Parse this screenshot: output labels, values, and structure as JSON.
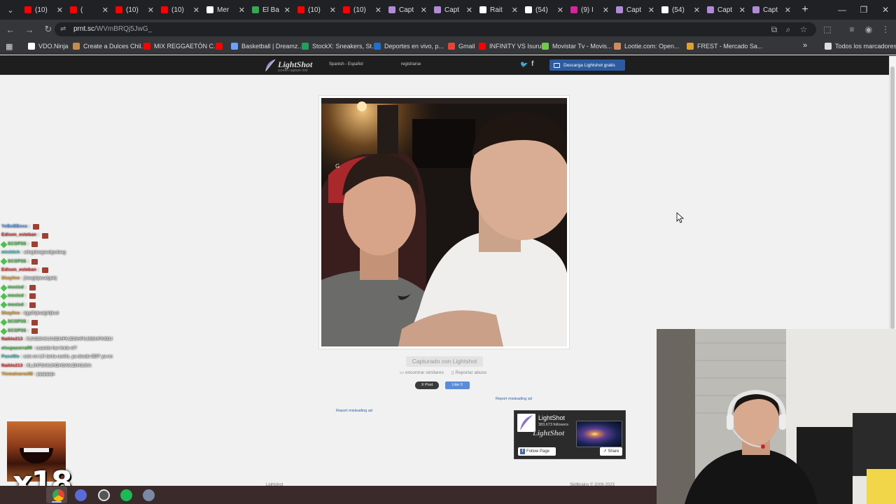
{
  "browser": {
    "tabs": [
      {
        "title": "(10)",
        "color": "#ff0000"
      },
      {
        "title": "(",
        "color": "#ff0000"
      },
      {
        "title": "(10)",
        "color": "#ff0000"
      },
      {
        "title": "(10)",
        "color": "#ff0000"
      },
      {
        "title": "Mer",
        "color": "#ffffff"
      },
      {
        "title": "El Ba",
        "color": "#34a853"
      },
      {
        "title": "(10)",
        "color": "#ff0000"
      },
      {
        "title": "(10)",
        "color": "#ff0000"
      },
      {
        "title": "Capt",
        "color": "#b38ad6"
      },
      {
        "title": "Capt",
        "color": "#b38ad6"
      },
      {
        "title": "Rait",
        "color": "#ffffff"
      },
      {
        "title": "(54)",
        "color": "#ffffff"
      },
      {
        "title": "(9) I",
        "color": "#d6249f"
      },
      {
        "title": "Capt",
        "color": "#b38ad6"
      },
      {
        "title": "(54)",
        "color": "#ffffff"
      },
      {
        "title": "Capt",
        "color": "#b38ad6"
      },
      {
        "title": "Capt",
        "color": "#b38ad6"
      }
    ],
    "new_tab": "+",
    "address": {
      "domain": "prnt.sc",
      "path": "/WVmBRQj5JwG_"
    },
    "bookmarks": [
      {
        "label": "VDO.Ninja",
        "color": "#ffffff"
      },
      {
        "label": "Create a Dulces Chil...",
        "color": "#c48b4a"
      },
      {
        "label": "MIX REGGAETÓN C...",
        "color": "#ff0000"
      },
      {
        "label": "",
        "color": "#ff0000"
      },
      {
        "label": "Basketball | Dreamz...",
        "color": "#6aa0ff"
      },
      {
        "label": "StockX: Sneakers, St...",
        "color": "#1fa15a"
      },
      {
        "label": "Deportes en vivo, p...",
        "color": "#1e6fd0"
      },
      {
        "label": "Gmail",
        "color": "#ea4335"
      },
      {
        "label": "INFINITY VS Isurus",
        "color": "#ff0000"
      },
      {
        "label": "Movistar Tv - Movis...",
        "color": "#6ecc4a"
      },
      {
        "label": "Lootie.com: Open...",
        "color": "#d38a5a"
      },
      {
        "label": "FREST - Mercado Sa...",
        "color": "#e0a030"
      },
      {
        "label": "Todos los marcadores",
        "color": "#dddddd"
      }
    ],
    "bookmark_overflow": "»"
  },
  "lightshot": {
    "logo": "LightShot",
    "logo_tagline": "screen capture tool",
    "language": "Spanish - Español",
    "register": "registrarse",
    "download": "Descarga Lightshot gratis",
    "captured_with": "Capturado con Lightshot",
    "find_similar": "encontrar similares",
    "report_abuse": "Reportar abuso",
    "x_post": "X Post",
    "fb_like": "Like 0",
    "report_ad_1": "Report misleading ad",
    "report_ad_2": "Report misleading ad",
    "fb_card": {
      "name": "LightShot",
      "followers": "383,673 followers",
      "watermark": "LightShot",
      "follow": "Follow Page",
      "share": "Share"
    },
    "footer_left": "Lightshot",
    "footer_right": "Skillbrains © 2009-2023"
  },
  "chat": [
    {
      "user": "YoBoBBoss",
      "color": "#5aa0ff",
      "msg": "",
      "emote": true,
      "diamond": false
    },
    {
      "user": "Edison_esteban",
      "color": "#e33b3b",
      "msg": "",
      "emote": true,
      "diamond": false
    },
    {
      "user": "SCOP3S",
      "color": "#4ec04e",
      "msg": "",
      "emote": true,
      "diamond": true
    },
    {
      "user": "mickitch",
      "color": "#3dc3c3",
      "msg": "adsgdasgasdgsdasg",
      "emote": false,
      "diamond": false
    },
    {
      "user": "SCOP3S",
      "color": "#4ec04e",
      "msg": "",
      "emote": true,
      "diamond": true
    },
    {
      "user": "Edison_esteban",
      "color": "#e33b3b",
      "msg": "",
      "emote": true,
      "diamond": false
    },
    {
      "user": "Skayline",
      "color": "#e0a030",
      "msg": "jhasghjassdgahj",
      "emote": false,
      "diamond": false
    },
    {
      "user": "moxixd",
      "color": "#4ec04e",
      "msg": "",
      "emote": true,
      "diamond": true
    },
    {
      "user": "moxixd",
      "color": "#4ec04e",
      "msg": "",
      "emote": true,
      "diamond": true
    },
    {
      "user": "moxixd",
      "color": "#4ec04e",
      "msg": "",
      "emote": true,
      "diamond": true
    },
    {
      "user": "Skayline",
      "color": "#e0a030",
      "msg": "kjgdfhjksdghfjksd",
      "emote": false,
      "diamond": false
    },
    {
      "user": "SCOP3S",
      "color": "#4ec04e",
      "msg": "",
      "emote": true,
      "diamond": true
    },
    {
      "user": "SCOP3S",
      "color": "#4ec04e",
      "msg": "",
      "emote": true,
      "diamond": true
    },
    {
      "user": "Naiklo213",
      "color": "#e33b3b",
      "msg": "KJADSHKJASDHFKJDSHFKJSDHFKSDJ",
      "emote": false,
      "diamond": false
    },
    {
      "user": "elsupazorra99",
      "color": "#4ec04e",
      "msg": "cuando fue lindo el?",
      "emote": false,
      "diamond": false
    },
    {
      "user": "PasoWo",
      "color": "#3dc3c3",
      "msg": "solo en LK tenia cuello, ya desde BBT ya no",
      "emote": false,
      "diamond": false
    },
    {
      "user": "Naiklo213",
      "color": "#e33b3b",
      "msg": "KLJHFSAKJHDHSAKJDHSJKA",
      "emote": false,
      "diamond": false
    },
    {
      "user": "Yinmalvarez08",
      "color": "#e0a030",
      "msg": "jajajajaja",
      "emote": false,
      "diamond": false
    }
  ],
  "overlay": {
    "multiplier": "x18"
  }
}
